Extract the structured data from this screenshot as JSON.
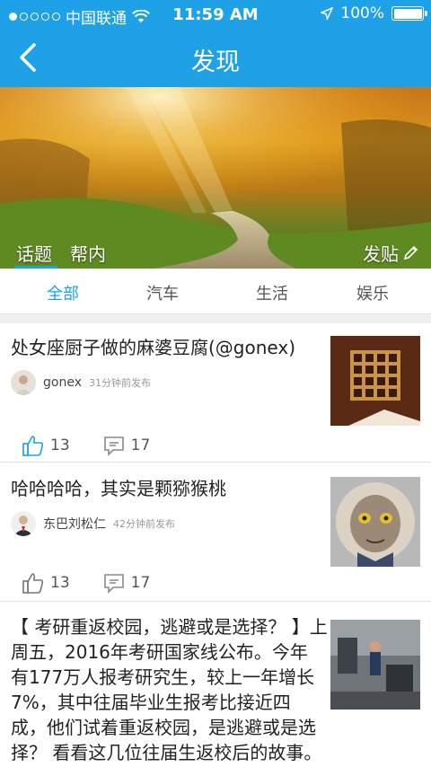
{
  "status": {
    "carrier": "中国联通",
    "time": "11:59 AM",
    "battery": "100%",
    "battery_level": 1.0
  },
  "nav": {
    "title": "发现"
  },
  "hero": {
    "tabs": [
      "话题",
      "帮内"
    ],
    "post_label": "发贴"
  },
  "categories": [
    "全部",
    "汽车",
    "生活",
    "娱乐"
  ],
  "posts": [
    {
      "title": "处女座厨子做的麻婆豆腐(@gonex)",
      "author": "gonex",
      "time": "31分钟前发布",
      "likes": "13",
      "comments": "17"
    },
    {
      "title": "哈哈哈哈，其实是颗猕猴桃",
      "author": "东巴刘松仁",
      "time": "42分钟前发布",
      "likes": "13",
      "comments": "17"
    },
    {
      "title_lines": [
        "【 考研重返校园，逃避或是选择？ 】上",
        "周五，2016年考研国家线公布。今年",
        "有177万人报考研究生，较上一年增长",
        "7%，其中往届毕业生报考比接近四",
        "成，他们试着重返校园，是逃避或是选",
        "择？ 看看这几位往届生返校后的故事。"
      ]
    }
  ]
}
